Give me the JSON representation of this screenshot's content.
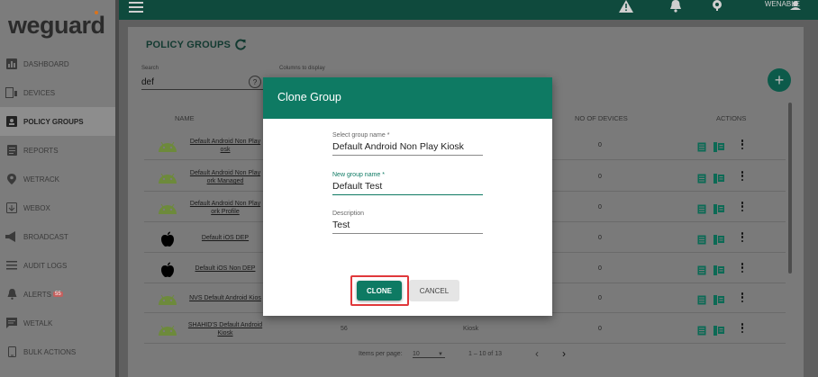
{
  "brand": {
    "logo_text": "weguard",
    "accent": "#0e7a63",
    "topbar_color": "#0f4a3d"
  },
  "topbar": {
    "user": "WENABLE",
    "icons": [
      "menu-icon",
      "warning-icon",
      "bell-icon",
      "gear-icon",
      "user-icon"
    ]
  },
  "sidebar": {
    "items": [
      {
        "label": "DASHBOARD",
        "icon": "dashboard-icon"
      },
      {
        "label": "DEVICES",
        "icon": "devices-icon"
      },
      {
        "label": "POLICY GROUPS",
        "icon": "policy-groups-icon",
        "active": true
      },
      {
        "label": "REPORTS",
        "icon": "reports-icon"
      },
      {
        "label": "WETRACK",
        "icon": "location-pin-icon"
      },
      {
        "label": "WEBOX",
        "icon": "webox-icon"
      },
      {
        "label": "BROADCAST",
        "icon": "megaphone-icon"
      },
      {
        "label": "AUDIT LOGS",
        "icon": "list-icon"
      },
      {
        "label": "ALERTS",
        "icon": "alert-bell-icon",
        "badge": "55"
      },
      {
        "label": "WETALK",
        "icon": "chat-icon"
      },
      {
        "label": "BULK ACTIONS",
        "icon": "phone-icon"
      }
    ]
  },
  "main": {
    "title": "POLICY GROUPS",
    "search": {
      "label": "Search",
      "value": "def"
    },
    "help": "?",
    "columns_label": "Columns to display",
    "fab": "+",
    "headers": {
      "name": "NAME",
      "devices": "NO OF DEVICES",
      "actions": "ACTIONS"
    },
    "rows": [
      {
        "os": "android",
        "name": "Default Android Non Play\nosk",
        "count": "0"
      },
      {
        "os": "android",
        "name": "Default Android Non Play\nork Managed",
        "count": "0"
      },
      {
        "os": "android",
        "name": "Default Android Non Play\nork Profile",
        "count": "0"
      },
      {
        "os": "apple",
        "name": "Default iOS DEP",
        "count": "0"
      },
      {
        "os": "apple",
        "name": "Default iOS Non DEP",
        "count": "0"
      },
      {
        "os": "android",
        "name": "NVS Default Android Kios",
        "count": "0"
      },
      {
        "os": "android",
        "name": "SHAHID'S Default Android\nKiosk",
        "count": "0",
        "col2": "56",
        "col3": "Kiosk"
      }
    ],
    "pager": {
      "label": "Items per page:",
      "per_page": "10",
      "range": "1 – 10 of 13"
    }
  },
  "modal": {
    "title": "Clone Group",
    "fields": [
      {
        "label": "Select group name *",
        "value": "Default Android Non Play Kiosk"
      },
      {
        "label": "New group name *",
        "value": "Default Test"
      },
      {
        "label": "Description",
        "value": "Test"
      }
    ],
    "clone_label": "CLONE",
    "cancel_label": "CANCEL"
  }
}
